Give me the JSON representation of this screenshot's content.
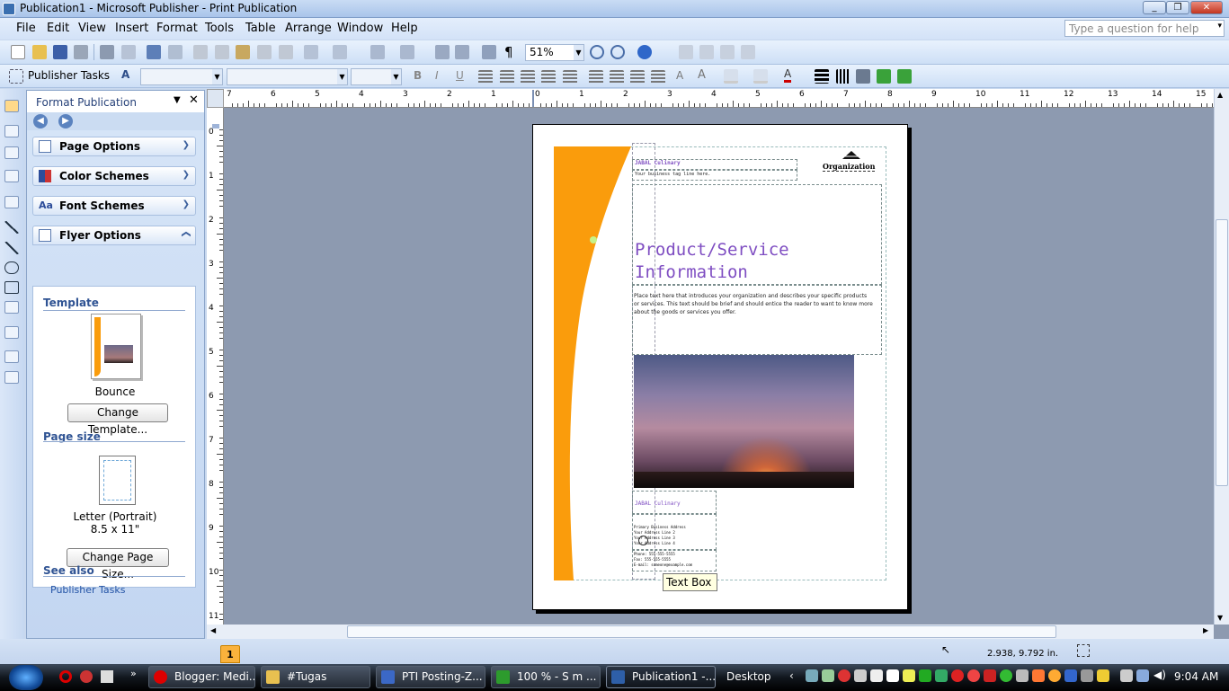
{
  "window": {
    "title": "Publication1 - Microsoft Publisher - Print Publication"
  },
  "menu": [
    "File",
    "Edit",
    "View",
    "Insert",
    "Format",
    "Tools",
    "Table",
    "Arrange",
    "Window",
    "Help"
  ],
  "help_placeholder": "Type a question for help",
  "toolbar": {
    "zoom": "51%",
    "publisher_tasks": "Publisher Tasks"
  },
  "panel": {
    "title": "Format Publication",
    "sections": {
      "page_options": "Page Options",
      "color_schemes": "Color Schemes",
      "font_schemes": "Font Schemes",
      "flyer_options": "Flyer Options"
    },
    "template_heading": "Template",
    "template_name": "Bounce",
    "change_template": "Change Template...",
    "page_size_heading": "Page size",
    "page_size_name": "Letter (Portrait)",
    "page_size_dims": "8.5 x 11\"",
    "change_page_size": "Change Page Size...",
    "see_also": "See also",
    "see_also_link": "Publisher Tasks"
  },
  "rulers": {
    "top_ticks": [
      "7",
      "6",
      "5",
      "4",
      "3",
      "2",
      "1",
      "0",
      "1",
      "2",
      "3",
      "4",
      "5",
      "6",
      "7",
      "8",
      "9",
      "10",
      "11",
      "12",
      "13",
      "14",
      "15"
    ],
    "left_ticks": [
      "0",
      "1",
      "2",
      "3",
      "4",
      "5",
      "6",
      "7",
      "8",
      "9",
      "10",
      "11"
    ]
  },
  "doc": {
    "org_name": "Organization",
    "company": "JABAL Culinary",
    "tagline": "Your business tag line here.",
    "heading_line1": "Product/Service",
    "heading_line2": "Information",
    "body": "Place text here that introduces your organization and describes your specific products or services. This text should be brief and should entice the reader to want to know more about the goods or services you offer.",
    "footer_company": "JABAL Culinary",
    "address_lines": [
      "Primary Business Address",
      "Your Address Line 2",
      "Your Address Line 3",
      "Your Address Line 4"
    ],
    "contact_lines": [
      "Phone: 555-555-5555",
      "Fax: 555-555-5555",
      "E-mail: someone@example.com"
    ],
    "tooltip": "Text Box"
  },
  "status": {
    "page_number": "1",
    "coords": "2.938, 9.792 in."
  },
  "taskbar": {
    "tasks": [
      "Blogger: Medi...",
      "#Tugas",
      "PTI Posting-Z...",
      "100 % - S m ...",
      "Publication1 -..."
    ],
    "desktop": "Desktop",
    "time": "9:04 AM"
  },
  "colors": {
    "orange": "#fa9c0c",
    "heading_purple": "#7f4ec2",
    "title_bar": "#b6cdec"
  }
}
